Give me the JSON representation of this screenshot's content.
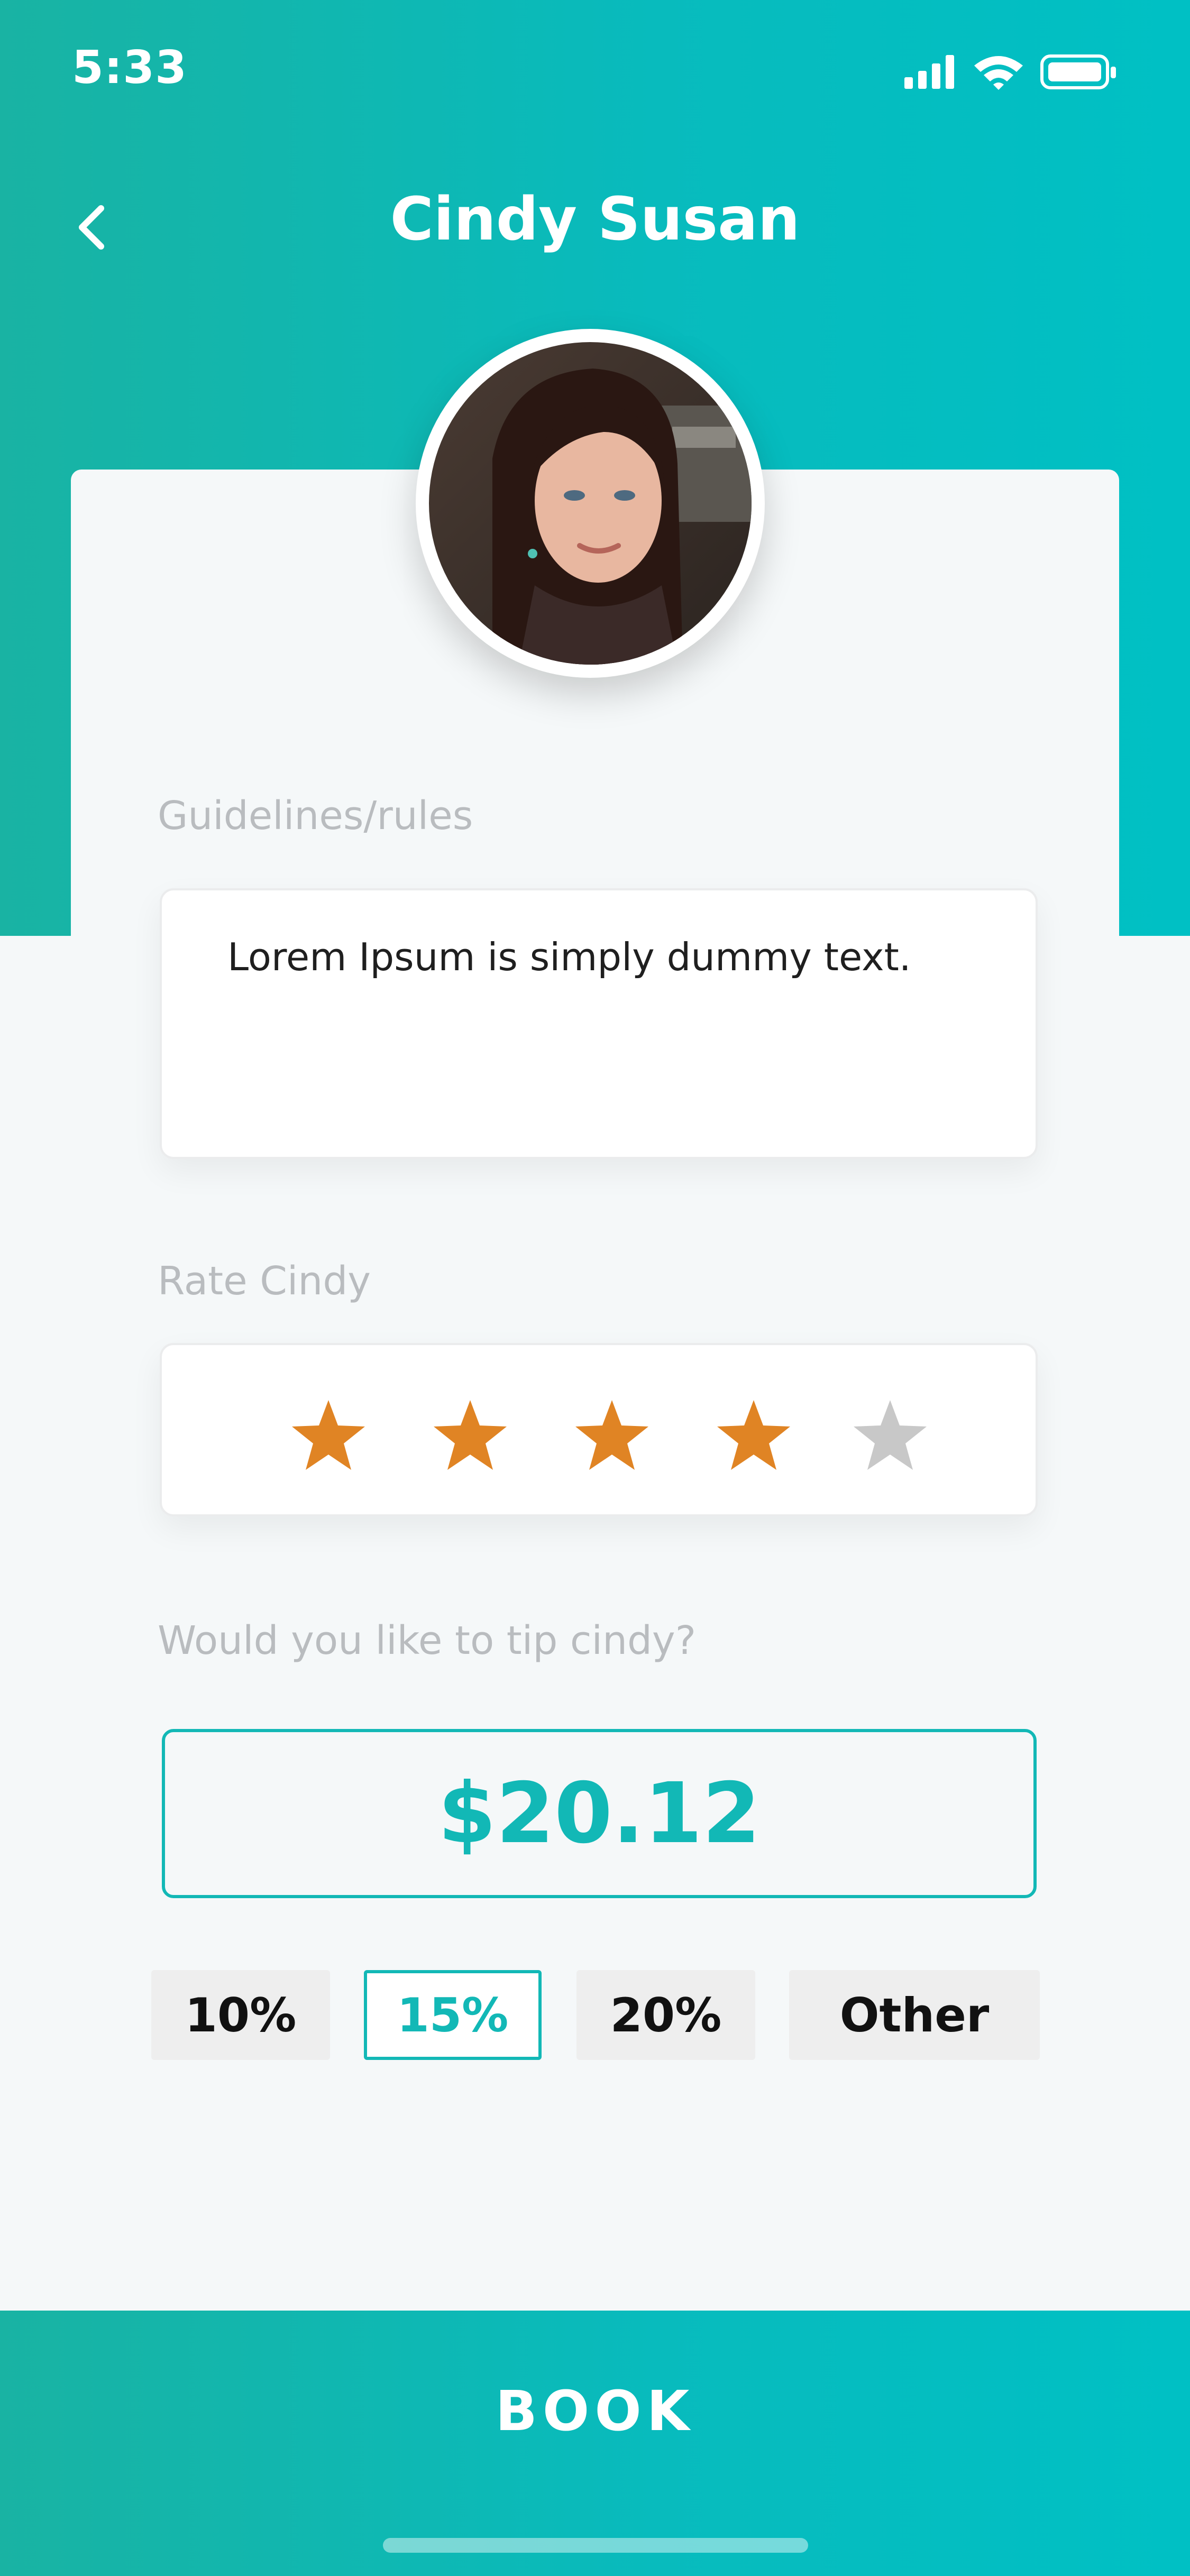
{
  "status_bar": {
    "time": "5:33",
    "icons": [
      "signal-icon",
      "wifi-icon",
      "battery-icon"
    ]
  },
  "header": {
    "title": "Cindy Susan",
    "back_icon": "chevron-left-icon"
  },
  "guidelines": {
    "label": "Guidelines/rules",
    "text": "Lorem Ipsum is simply dummy text."
  },
  "rating": {
    "label": "Rate Cindy",
    "value": 4,
    "max": 5,
    "filled_color": "#e08424",
    "empty_color": "#c8c8c8"
  },
  "tip": {
    "label": "Would you like to tip cindy?",
    "amount": "$20.12",
    "options": [
      {
        "label": "10%",
        "selected": false
      },
      {
        "label": "15%",
        "selected": true
      },
      {
        "label": "20%",
        "selected": false
      },
      {
        "label": "Other",
        "selected": false
      }
    ]
  },
  "footer": {
    "book_label": "BOOK"
  },
  "colors": {
    "accent": "#12b8b6",
    "header_start": "#19b3a3",
    "header_end": "#00c0c4"
  }
}
